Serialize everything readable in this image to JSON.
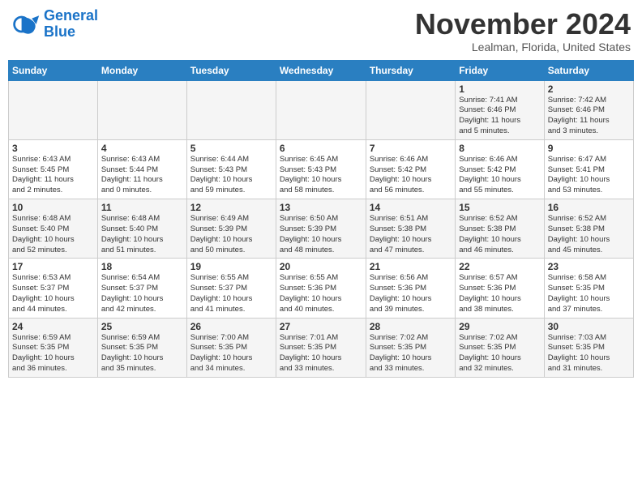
{
  "header": {
    "logo_line1": "General",
    "logo_line2": "Blue",
    "month": "November 2024",
    "location": "Lealman, Florida, United States"
  },
  "weekdays": [
    "Sunday",
    "Monday",
    "Tuesday",
    "Wednesday",
    "Thursday",
    "Friday",
    "Saturday"
  ],
  "weeks": [
    [
      {
        "day": "",
        "info": ""
      },
      {
        "day": "",
        "info": ""
      },
      {
        "day": "",
        "info": ""
      },
      {
        "day": "",
        "info": ""
      },
      {
        "day": "",
        "info": ""
      },
      {
        "day": "1",
        "info": "Sunrise: 7:41 AM\nSunset: 6:46 PM\nDaylight: 11 hours\nand 5 minutes."
      },
      {
        "day": "2",
        "info": "Sunrise: 7:42 AM\nSunset: 6:46 PM\nDaylight: 11 hours\nand 3 minutes."
      }
    ],
    [
      {
        "day": "3",
        "info": "Sunrise: 6:43 AM\nSunset: 5:45 PM\nDaylight: 11 hours\nand 2 minutes."
      },
      {
        "day": "4",
        "info": "Sunrise: 6:43 AM\nSunset: 5:44 PM\nDaylight: 11 hours\nand 0 minutes."
      },
      {
        "day": "5",
        "info": "Sunrise: 6:44 AM\nSunset: 5:43 PM\nDaylight: 10 hours\nand 59 minutes."
      },
      {
        "day": "6",
        "info": "Sunrise: 6:45 AM\nSunset: 5:43 PM\nDaylight: 10 hours\nand 58 minutes."
      },
      {
        "day": "7",
        "info": "Sunrise: 6:46 AM\nSunset: 5:42 PM\nDaylight: 10 hours\nand 56 minutes."
      },
      {
        "day": "8",
        "info": "Sunrise: 6:46 AM\nSunset: 5:42 PM\nDaylight: 10 hours\nand 55 minutes."
      },
      {
        "day": "9",
        "info": "Sunrise: 6:47 AM\nSunset: 5:41 PM\nDaylight: 10 hours\nand 53 minutes."
      }
    ],
    [
      {
        "day": "10",
        "info": "Sunrise: 6:48 AM\nSunset: 5:40 PM\nDaylight: 10 hours\nand 52 minutes."
      },
      {
        "day": "11",
        "info": "Sunrise: 6:48 AM\nSunset: 5:40 PM\nDaylight: 10 hours\nand 51 minutes."
      },
      {
        "day": "12",
        "info": "Sunrise: 6:49 AM\nSunset: 5:39 PM\nDaylight: 10 hours\nand 50 minutes."
      },
      {
        "day": "13",
        "info": "Sunrise: 6:50 AM\nSunset: 5:39 PM\nDaylight: 10 hours\nand 48 minutes."
      },
      {
        "day": "14",
        "info": "Sunrise: 6:51 AM\nSunset: 5:38 PM\nDaylight: 10 hours\nand 47 minutes."
      },
      {
        "day": "15",
        "info": "Sunrise: 6:52 AM\nSunset: 5:38 PM\nDaylight: 10 hours\nand 46 minutes."
      },
      {
        "day": "16",
        "info": "Sunrise: 6:52 AM\nSunset: 5:38 PM\nDaylight: 10 hours\nand 45 minutes."
      }
    ],
    [
      {
        "day": "17",
        "info": "Sunrise: 6:53 AM\nSunset: 5:37 PM\nDaylight: 10 hours\nand 44 minutes."
      },
      {
        "day": "18",
        "info": "Sunrise: 6:54 AM\nSunset: 5:37 PM\nDaylight: 10 hours\nand 42 minutes."
      },
      {
        "day": "19",
        "info": "Sunrise: 6:55 AM\nSunset: 5:37 PM\nDaylight: 10 hours\nand 41 minutes."
      },
      {
        "day": "20",
        "info": "Sunrise: 6:55 AM\nSunset: 5:36 PM\nDaylight: 10 hours\nand 40 minutes."
      },
      {
        "day": "21",
        "info": "Sunrise: 6:56 AM\nSunset: 5:36 PM\nDaylight: 10 hours\nand 39 minutes."
      },
      {
        "day": "22",
        "info": "Sunrise: 6:57 AM\nSunset: 5:36 PM\nDaylight: 10 hours\nand 38 minutes."
      },
      {
        "day": "23",
        "info": "Sunrise: 6:58 AM\nSunset: 5:35 PM\nDaylight: 10 hours\nand 37 minutes."
      }
    ],
    [
      {
        "day": "24",
        "info": "Sunrise: 6:59 AM\nSunset: 5:35 PM\nDaylight: 10 hours\nand 36 minutes."
      },
      {
        "day": "25",
        "info": "Sunrise: 6:59 AM\nSunset: 5:35 PM\nDaylight: 10 hours\nand 35 minutes."
      },
      {
        "day": "26",
        "info": "Sunrise: 7:00 AM\nSunset: 5:35 PM\nDaylight: 10 hours\nand 34 minutes."
      },
      {
        "day": "27",
        "info": "Sunrise: 7:01 AM\nSunset: 5:35 PM\nDaylight: 10 hours\nand 33 minutes."
      },
      {
        "day": "28",
        "info": "Sunrise: 7:02 AM\nSunset: 5:35 PM\nDaylight: 10 hours\nand 33 minutes."
      },
      {
        "day": "29",
        "info": "Sunrise: 7:02 AM\nSunset: 5:35 PM\nDaylight: 10 hours\nand 32 minutes."
      },
      {
        "day": "30",
        "info": "Sunrise: 7:03 AM\nSunset: 5:35 PM\nDaylight: 10 hours\nand 31 minutes."
      }
    ]
  ]
}
